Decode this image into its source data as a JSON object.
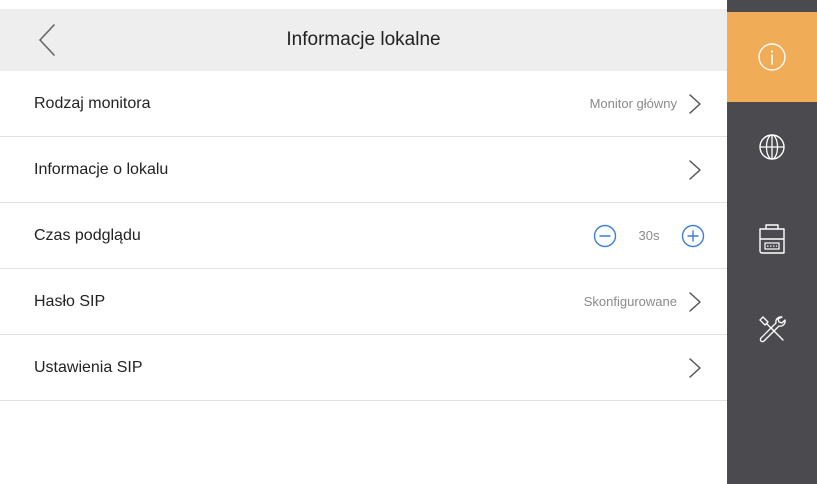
{
  "header": {
    "title": "Informacje lokalne"
  },
  "rows": [
    {
      "label": "Rodzaj monitora",
      "value": "Monitor główny"
    },
    {
      "label": "Informacje o lokalu",
      "value": ""
    },
    {
      "label": "Czas podglądu",
      "value": "30s"
    },
    {
      "label": "Hasło SIP",
      "value": "Skonfigurowane"
    },
    {
      "label": "Ustawienia SIP",
      "value": ""
    }
  ],
  "sidebar": {
    "items": [
      {
        "icon": "info-icon",
        "active": true
      },
      {
        "icon": "globe-icon",
        "active": false
      },
      {
        "icon": "device-icon",
        "active": false
      },
      {
        "icon": "tools-icon",
        "active": false
      }
    ]
  },
  "colors": {
    "accent": "#f0ac57",
    "sidebar": "#4a4a4f",
    "header": "#eeeeee",
    "stepper": "#3b7ddd"
  }
}
